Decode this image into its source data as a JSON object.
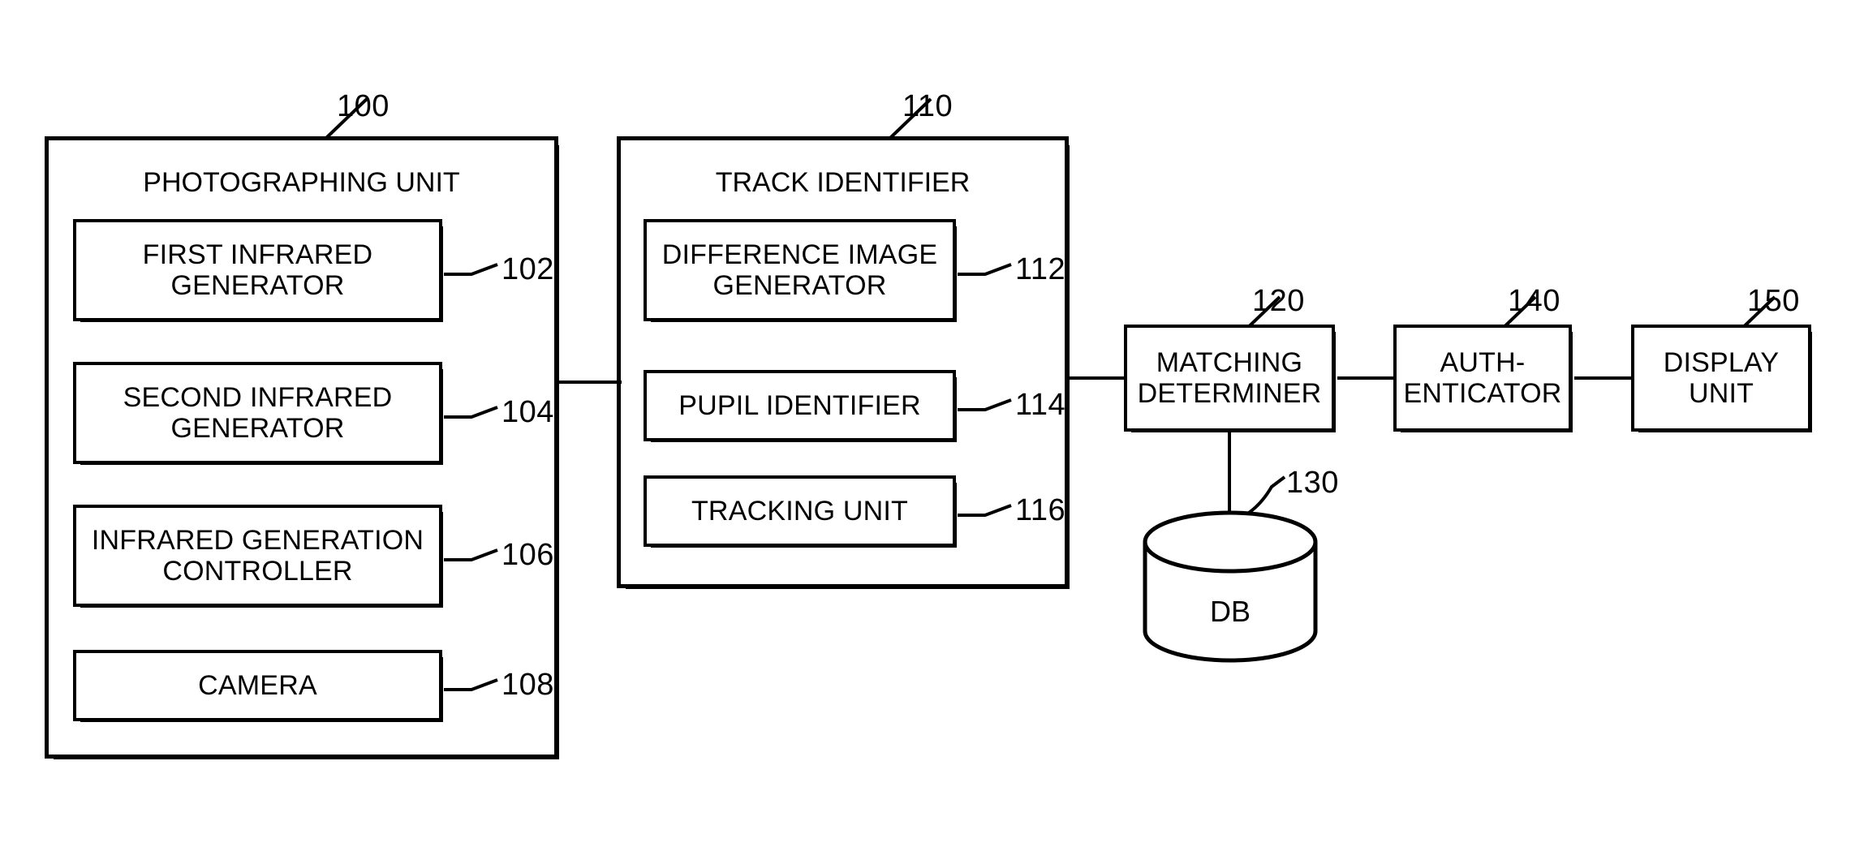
{
  "figure": {
    "type": "patent-block-diagram",
    "background_color": "#ffffff",
    "line_color": "#000000"
  },
  "photographing_unit": {
    "title": "PHOTOGRAPHING UNIT",
    "ref": "100",
    "blocks": [
      {
        "label": "FIRST INFRARED\nGENERATOR",
        "ref": "102"
      },
      {
        "label": "SECOND INFRARED\nGENERATOR",
        "ref": "104"
      },
      {
        "label": "INFRARED GENERATION\nCONTROLLER",
        "ref": "106"
      },
      {
        "label": "CAMERA",
        "ref": "108"
      }
    ]
  },
  "track_identifier": {
    "title": "TRACK IDENTIFIER",
    "ref": "110",
    "blocks": [
      {
        "label": "DIFFERENCE IMAGE\nGENERATOR",
        "ref": "112"
      },
      {
        "label": "PUPIL IDENTIFIER",
        "ref": "114"
      },
      {
        "label": "TRACKING UNIT",
        "ref": "116"
      }
    ]
  },
  "matching_determiner": {
    "label": "MATCHING\nDETERMINER",
    "ref": "120"
  },
  "database": {
    "label": "DB",
    "ref": "130"
  },
  "authenticator": {
    "label": "AUTH-\nENTICATOR",
    "ref": "140"
  },
  "display_unit": {
    "label": "DISPLAY\nUNIT",
    "ref": "150"
  }
}
